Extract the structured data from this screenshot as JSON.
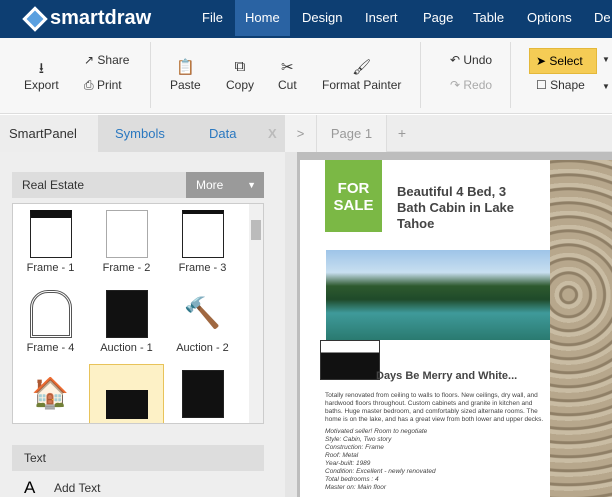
{
  "app": {
    "name": "smartdraw"
  },
  "menu": [
    "File",
    "Home",
    "Design",
    "Insert",
    "Page",
    "Table",
    "Options",
    "De"
  ],
  "toolbar": {
    "export": "Export",
    "share": "Share",
    "print": "Print",
    "paste": "Paste",
    "copy": "Copy",
    "cut": "Cut",
    "format_painter": "Format Painter",
    "undo": "Undo",
    "redo": "Redo",
    "select": "Select",
    "shape": "Shape"
  },
  "panel_tabs": {
    "smartpanel": "SmartPanel",
    "symbols": "Symbols",
    "data": "Data",
    "close": "X",
    "expand": ">",
    "page": "Page 1",
    "add": "+"
  },
  "library": {
    "name": "Real Estate",
    "more": "More"
  },
  "symbols": [
    "Frame - 1",
    "Frame - 2",
    "Frame - 3",
    "Frame - 4",
    "Auction - 1",
    "Auction - 2",
    "",
    "",
    ""
  ],
  "text_section": {
    "title": "Text",
    "add_text": "Add Text"
  },
  "doc": {
    "badge_line1": "FOR",
    "badge_line2": "SALE",
    "title": "Beautiful 4 Bed, 3 Bath Cabin in Lake Tahoe",
    "subtitle": "Days Be Merry and White...",
    "paragraph": "Totally renovated from ceiling to walls to floors. New ceilings, dry wall, and hardwood floors throughout. Custom cabinets and granite in kitchen and baths. Huge master bedroom, and comfortably sized alternate rooms. The home is on the lake, and has a great view from both lower and upper decks.",
    "details": [
      "Motivated seller! Room to negotiate",
      "Style: Cabin, Two story",
      "Construction: Frame",
      "Roof: Metal",
      "Year-built: 1989",
      "Condition: Excellent - newly renovated",
      "Total bedrooms : 4",
      "Master on: Main floor"
    ]
  }
}
